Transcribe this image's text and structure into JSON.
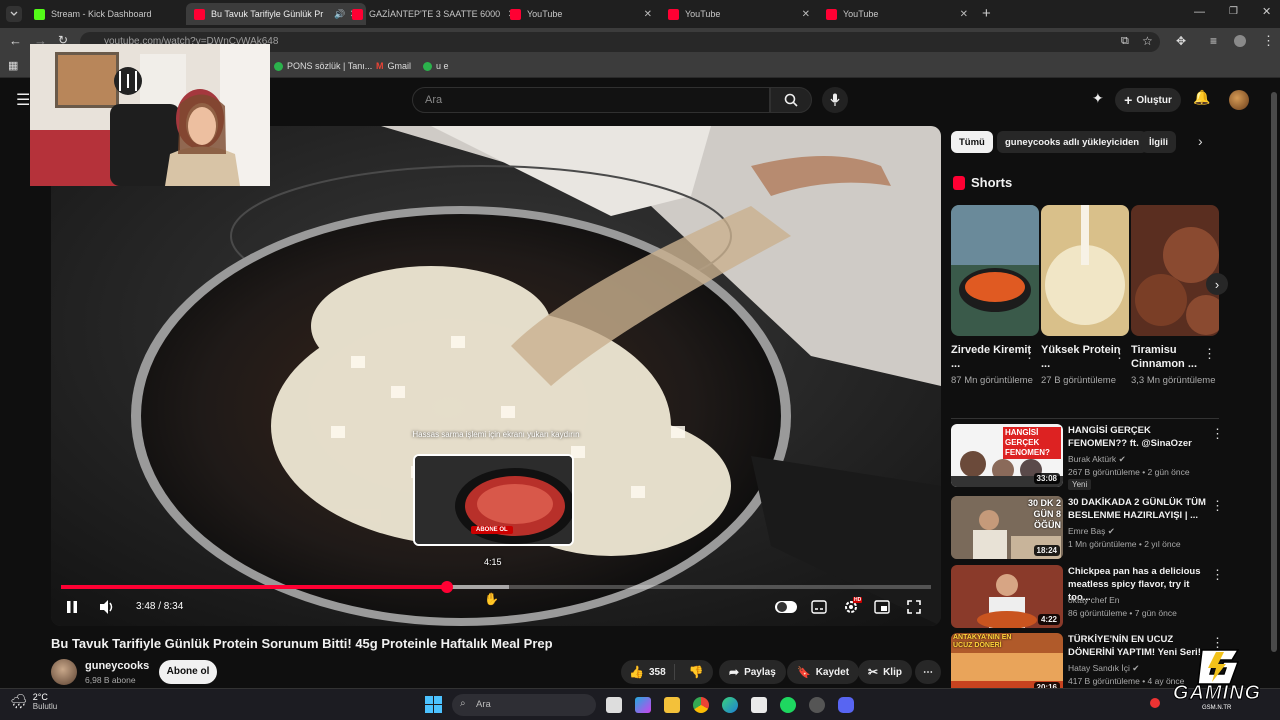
{
  "browser": {
    "tabs": [
      {
        "title": "Stream - Kick Dashboard",
        "color": "#53fc18"
      },
      {
        "title": "Bu Tavuk Tarifiyle Günlük Pr",
        "color": "#ff0033"
      },
      {
        "title": "GAZİANTEP'TE 3 SAATTE 6000",
        "color": "#ff0033"
      },
      {
        "title": "YouTube",
        "color": "#ff0033"
      },
      {
        "title": "YouTube",
        "color": "#ff0033"
      },
      {
        "title": "YouTube",
        "color": "#ff0033"
      }
    ],
    "new_tab": "+",
    "url": "youtube.com/watch?v=DWnCvWAk648",
    "bookmarks": [
      "PONS sözlük | Tanı...",
      "Gmail",
      "u e"
    ]
  },
  "youtube": {
    "search_placeholder": "Ara",
    "create_label": "Oluştur"
  },
  "video": {
    "time_current": "3:48",
    "time_total": "8:34",
    "time_display": "3:48 / 8:34",
    "hover_time": "4:15",
    "progress_fraction": 0.444,
    "buffer_fraction": 0.515,
    "drag_hint": "Hassas sarma işlemi için ekranı yukarı kaydırın",
    "preview_badge": "ABONE OL",
    "title": "Bu Tavuk Tarifiyle Günlük Protein Sorunum Bitti! 45g Proteinle Haftalık Meal Prep",
    "channel": "guneycooks",
    "subscribers": "6,98 B abone",
    "subscribe_label": "Abone ol",
    "likes": "358",
    "share_label": "Paylaş",
    "save_label": "Kaydet",
    "clip_label": "Klip"
  },
  "sidebar": {
    "chips": [
      "Tümü",
      "guneycooks adlı yükleyiciden",
      "İlgili"
    ],
    "shorts_heading": "Shorts",
    "shorts": [
      {
        "title": "Zirvede Kiremit ...",
        "views": "87 Mn görüntüleme"
      },
      {
        "title": "Yüksek Protein ...",
        "views": "27 B görüntüleme"
      },
      {
        "title": "Tiramisu Cinnamon ...",
        "views": "3,3 Mn görüntüleme"
      }
    ],
    "recommended": [
      {
        "title": "HANGİSİ GERÇEK FENOMEN?? ft. @SinaOzer",
        "channel": "Burak Aktürk",
        "meta": "267 B görüntüleme • 2 gün önce",
        "badge": "Yeni",
        "duration": "33:08",
        "thumb_text": "HANGİSİ GERÇEK FENOMEN?"
      },
      {
        "title": "30 DAKİKADA 2 GÜNLÜK TÜM BESLENME HAZIRLAYIŞI | ...",
        "channel": "Emre Baş",
        "meta": "1 Mn görüntüleme • 2 yıl önce",
        "duration": "18:24",
        "thumb_text": "30 DK 2 GÜN 8 ÖĞÜN"
      },
      {
        "title": "Chickpea pan has a delicious meatless spicy flavor, try it too...",
        "channel": "oktay chef En",
        "meta": "86 görüntüleme • 7 gün önce",
        "duration": "4:22"
      },
      {
        "title": "TÜRKİYE'NİN EN UCUZ DÖNERİNİ YAPTIM! Yeni Seri!",
        "channel": "Hatay Sandık İçi",
        "meta": "417 B görüntüleme • 4 ay önce",
        "duration": "20:16",
        "thumb_text": "ANTAKYA'NIN EN UCUZ DÖNERİ"
      }
    ]
  },
  "taskbar": {
    "weather_temp": "2°C",
    "weather_desc": "Bulutlu",
    "search_placeholder": "Ara"
  },
  "overlay": {
    "logo_text": "GAMING",
    "logo_sub": "GSM.N.TR"
  },
  "colors": {
    "accent_red": "#ff0033",
    "yt_bg": "#0f0f0f"
  }
}
